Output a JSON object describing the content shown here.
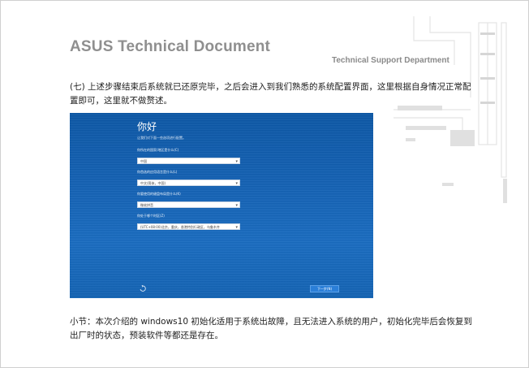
{
  "header": {
    "title": "ASUS Technical Document",
    "department": "Technical Support Department"
  },
  "paragraphs": {
    "step7": "(七) 上述步骤结束后系统就已还原完毕，之后会进入到我们熟悉的系统配置界面，这里根据自身情况正常配置即可，这里就不做赘述。",
    "summary": "小节：本次介绍的 windows10 初始化适用于系统出故障，且无法进入系统的用户，初始化完毕后会恢复到出厂时的状态，预装软件等都还是存在。"
  },
  "screenshot": {
    "greeting": "你好",
    "subtitle": "让我们对下面一些选项进行配置。",
    "fields": [
      {
        "label": "你所在的国家/地区是什么(C)",
        "value": "中国"
      },
      {
        "label": "你首选的应用语言是什么(L)",
        "value": "中文(简体，中国)"
      },
      {
        "label": "你要使用的键盘布局是什么(K)",
        "value": "微软拼音"
      },
      {
        "label": "你处于哪个时区(Z)",
        "value": "(UTC+08:00)北京，重庆，香港特别行政区，乌鲁木齐"
      }
    ],
    "next_button": "下一步(N)",
    "colors": {
      "background": "#1463b3",
      "button": "#2b7fd8"
    }
  }
}
